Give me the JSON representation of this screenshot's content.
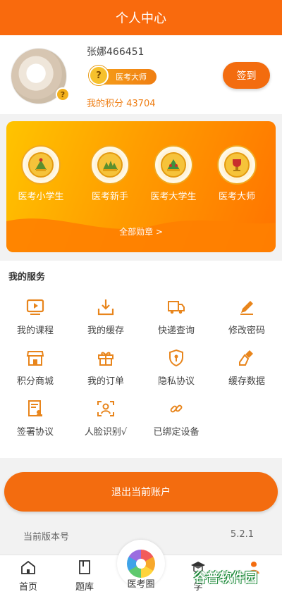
{
  "header": {
    "title": "个人中心"
  },
  "profile": {
    "username": "张娜466451",
    "rank_badge_symbol": "?",
    "rank_label": "医考大师",
    "points_text": "我的积分 43704",
    "sign_in_label": "签到"
  },
  "medals": {
    "items": [
      {
        "label": "医考小学生",
        "icon": "medal-trophy-icon"
      },
      {
        "label": "医考新手",
        "icon": "medal-trophy-icon"
      },
      {
        "label": "医考大学生",
        "icon": "medal-trophy-icon"
      },
      {
        "label": "医考大师",
        "icon": "medal-cup-icon"
      }
    ],
    "all_link": "全部勋章 >"
  },
  "services": {
    "title": "我的服务",
    "items": [
      {
        "label": "我的课程",
        "icon": "video-icon"
      },
      {
        "label": "我的缓存",
        "icon": "download-icon"
      },
      {
        "label": "快递查询",
        "icon": "truck-icon"
      },
      {
        "label": "修改密码",
        "icon": "pencil-icon"
      },
      {
        "label": "积分商城",
        "icon": "shop-icon"
      },
      {
        "label": "我的订单",
        "icon": "gift-icon"
      },
      {
        "label": "隐私协议",
        "icon": "shield-icon"
      },
      {
        "label": "缓存数据",
        "icon": "broom-icon"
      },
      {
        "label": "签署协议",
        "icon": "contract-icon"
      },
      {
        "label": "人脸识别√",
        "icon": "face-scan-icon"
      },
      {
        "label": "已绑定设备",
        "icon": "link-icon"
      }
    ]
  },
  "logout_label": "退出当前账户",
  "version": {
    "label": "当前版本号",
    "value": "5.2.1"
  },
  "tabbar": {
    "items": [
      {
        "label": "首页",
        "icon": "home-icon"
      },
      {
        "label": "题库",
        "icon": "book-icon"
      },
      {
        "label": "医考圈",
        "icon": "flower-icon"
      },
      {
        "label": "学",
        "icon": "graduation-icon"
      },
      {
        "label": "",
        "icon": "user-icon"
      }
    ]
  },
  "watermark": "谷普软件园",
  "colors": {
    "accent": "#f36c0f",
    "header": "#f96a0d",
    "icon": "#e8851c"
  }
}
